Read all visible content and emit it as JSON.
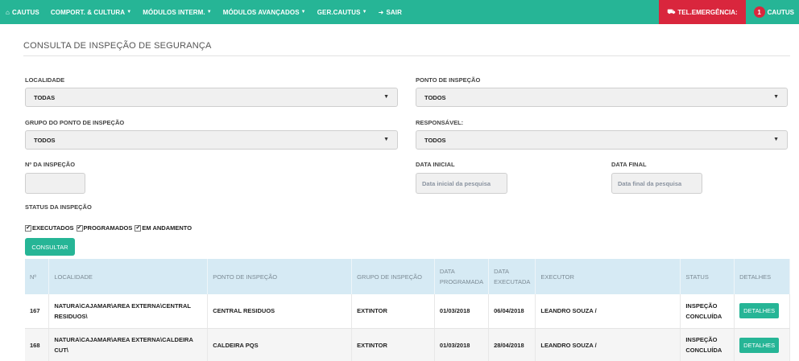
{
  "nav": {
    "home": "CAUTUS",
    "items": [
      "COMPORT. & CULTURA",
      "MÓDULOS INTERM.",
      "MÓDULOS AVANÇADOS",
      "GER.CAUTUS"
    ],
    "logout": "SAIR",
    "emergency": "TEL.EMERGÊNCIA:",
    "notifications": "1",
    "user": "CAUTUS"
  },
  "page_title": "CONSULTA DE INSPEÇÃO DE SEGURANÇA",
  "form": {
    "localidade": {
      "label": "LOCALIDADE",
      "value": "TODAS"
    },
    "ponto": {
      "label": "PONTO DE INSPEÇÃO",
      "value": "TODOS"
    },
    "grupo": {
      "label": "GRUPO DO PONTO DE INSPEÇÃO",
      "value": "TODOS"
    },
    "responsavel": {
      "label": "RESPONSÁVEL:",
      "value": "TODOS"
    },
    "numero": {
      "label": "Nº DA INSPEÇÃO",
      "value": ""
    },
    "data_inicial": {
      "label": "DATA INICIAL",
      "placeholder": "Data inicial da pesquisa"
    },
    "data_final": {
      "label": "DATA FINAL",
      "placeholder": "Data final da pesquisa"
    },
    "status_label": "STATUS DA INSPEÇÃO",
    "status_options": [
      "EXECUTADOS",
      "PROGRAMADOS",
      "EM ANDAMENTO"
    ],
    "submit": "CONSULTAR"
  },
  "table": {
    "headers": [
      "Nº",
      "LOCALIDADE",
      "PONTO DE INSPEÇÃO",
      "GRUPO DE INSPEÇÃO",
      "DATA PROGRAMADA",
      "DATA EXECUTADA",
      "EXECUTOR",
      "STATUS",
      "DETALHES"
    ],
    "rows": [
      {
        "num": "167",
        "localidade": "NATURA\\CAJAMAR\\AREA EXTERNA\\CENTRAL RESIDUOS\\",
        "ponto": "CENTRAL RESIDUOS",
        "grupo": "EXTINTOR",
        "programada": "01/03/2018",
        "executada": "06/04/2018",
        "executor": "LEANDRO SOUZA /",
        "status": "INSPEÇÃO CONCLUÍDA",
        "detalhes": "DETALHES"
      },
      {
        "num": "168",
        "localidade": "NATURA\\CAJAMAR\\AREA EXTERNA\\CALDEIRA CUT\\",
        "ponto": "CALDEIRA PQS",
        "grupo": "EXTINTOR",
        "programada": "01/03/2018",
        "executada": "28/04/2018",
        "executor": "LEANDRO SOUZA /",
        "status": "INSPEÇÃO CONCLUÍDA",
        "detalhes": "DETALHES"
      }
    ]
  }
}
